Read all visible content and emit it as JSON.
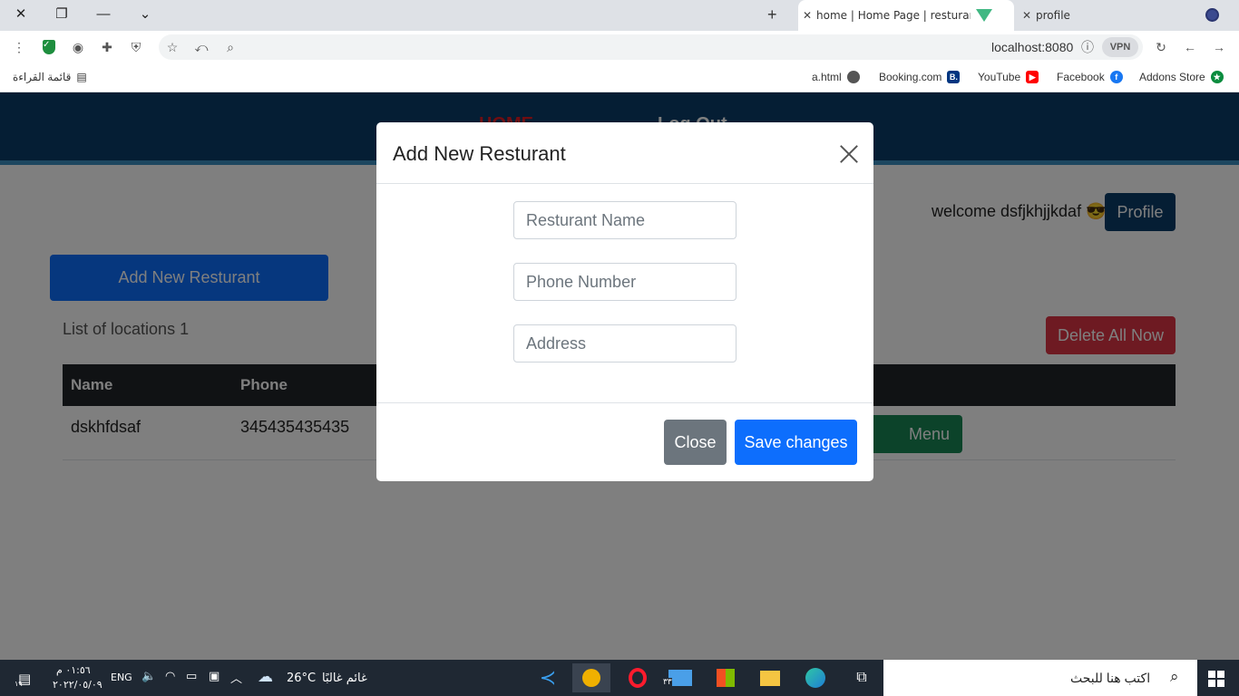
{
  "browser": {
    "tabs": [
      {
        "title": "home | Home Page | resturant sy",
        "active": true
      },
      {
        "title": "profile",
        "active": false
      }
    ],
    "url": "localhost:8080",
    "vpn_label": "VPN",
    "bookmarks": [
      {
        "label": "a.html"
      },
      {
        "label": "Booking.com",
        "icon_text": "B."
      },
      {
        "label": "YouTube"
      },
      {
        "label": "Facebook"
      },
      {
        "label": "Addons Store"
      }
    ],
    "reading_list": "قائمة القراءة"
  },
  "nav": {
    "home": "HOME",
    "logout": "Log Out"
  },
  "main": {
    "welcome": "welcome dsfjkhjjkdaf 😎",
    "profile_button": "Profile",
    "add_button": "Add New Resturant",
    "list_count": "List of locations 1",
    "delete_all_button": "Delete All Now",
    "table": {
      "headers": [
        "Name",
        "Phone"
      ],
      "rows": [
        {
          "name": "dskhfdsaf",
          "phone": "345435435435",
          "menu_button": "Menu"
        }
      ]
    }
  },
  "modal": {
    "title": "Add New Resturant",
    "fields": {
      "name_placeholder": "Resturant Name",
      "phone_placeholder": "Phone Number",
      "address_placeholder": "Address"
    },
    "close_button": "Close",
    "save_button": "Save changes"
  },
  "taskbar": {
    "time": "٠١:٥٦ م",
    "date": "٢٠٢٢/٠٥/٠٩",
    "language": "ENG",
    "temperature": "26°C",
    "weather": "غائم غالبًا",
    "search_placeholder": "اكتب هنا للبحث",
    "notification_count": "١٩",
    "mail_count": "٣٣"
  },
  "colors": {
    "navbar": "#0b3d68",
    "navbar_accent": "#3a8fc1",
    "home_link": "#e31b23",
    "primary": "#0d6efd",
    "danger": "#dc3545",
    "success": "#198754",
    "secondary": "#6c757d"
  }
}
